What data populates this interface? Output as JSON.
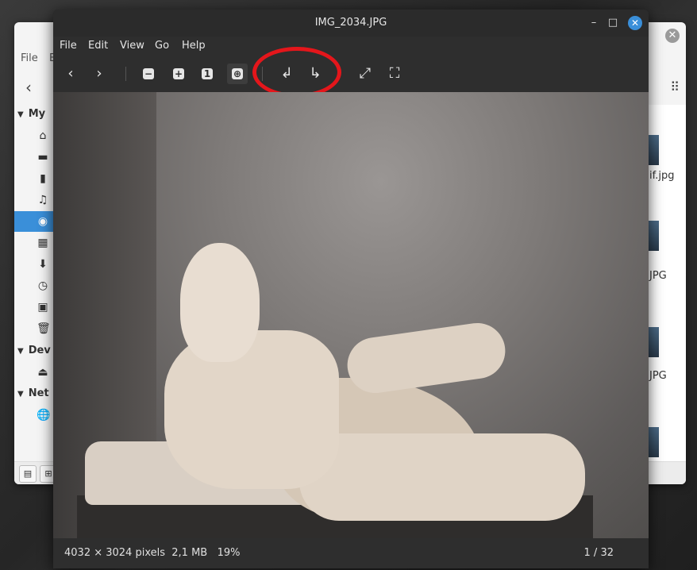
{
  "background_window": {
    "menu": {
      "file": "File",
      "edit": "E"
    },
    "sidebar_headers": [
      {
        "label": "My"
      },
      {
        "label": "Dev"
      },
      {
        "label": "Net"
      }
    ],
    "sidebar_icons": [
      "home-icon",
      "desktop-icon",
      "documents-icon",
      "music-icon",
      "pictures-icon",
      "videos-icon",
      "downloads-icon",
      "recent-icon",
      "file-system-icon",
      "trash-icon",
      "drive-icon",
      "network-icon"
    ],
    "file_labels": [
      "if.jpg",
      "JPG",
      "JPG"
    ]
  },
  "viewer": {
    "title": "IMG_2034.JPG",
    "menu": [
      "File",
      "Edit",
      "View",
      "Go",
      "Help"
    ],
    "zoom_reset_label": "1",
    "status_info": "4032 × 3024 pixels  2,1 MB   19%",
    "page_counter": "1 / 32"
  },
  "colors": {
    "accent": "#3a8fd9",
    "annotation": "#e4161b",
    "viewer_bg": "#2e2e2e"
  }
}
